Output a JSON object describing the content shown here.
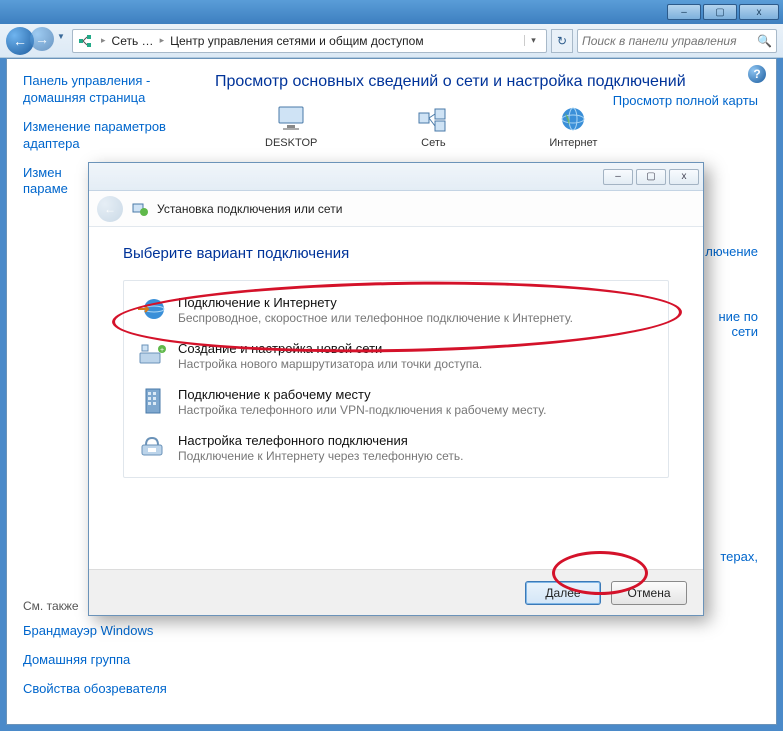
{
  "outer_window": {
    "minimize": "–",
    "maximize": "▢",
    "close": "x"
  },
  "nav": {
    "back_glyph": "←",
    "fwd_glyph": "→",
    "drop_glyph": "▼"
  },
  "address": {
    "crumb1": "Сеть …",
    "crumb2": "Центр управления сетями и общим доступом",
    "sep": "▸",
    "drop": "▾",
    "refresh": "↻"
  },
  "search": {
    "placeholder": "Поиск в панели управления",
    "icon": "🔍"
  },
  "sidebar": {
    "link1": "Панель управления - домашняя страница",
    "link2": "Изменение параметров адаптера",
    "link3": "Измен",
    "link3b": "параме",
    "see_also": "См. также",
    "link4": "Брандмауэр Windows",
    "link5": "Домашняя группа",
    "link6": "Свойства обозревателя"
  },
  "main": {
    "heading": "Просмотр основных сведений о сети и настройка подключений",
    "map_link": "Просмотр полной карты",
    "node1": "DESKTOP",
    "node2": "Сеть",
    "node3": "Интернет",
    "rlink_suffix": "лючение",
    "rlink2a": "ние по",
    "rlink2b": "сети",
    "rlink3": "терах,"
  },
  "wizard": {
    "titlebar": {
      "min": "–",
      "max": "▢",
      "close": "x"
    },
    "back_glyph": "←",
    "title": "Установка подключения или сети",
    "heading": "Выберите вариант подключения",
    "options": [
      {
        "title": "Подключение к Интернету",
        "desc": "Беспроводное, скоростное или телефонное подключение к Интернету."
      },
      {
        "title": "Создание и настройка новой сети",
        "desc": "Настройка нового маршрутизатора или точки доступа."
      },
      {
        "title": "Подключение к рабочему месту",
        "desc": "Настройка телефонного или VPN-подключения к рабочему месту."
      },
      {
        "title": "Настройка телефонного подключения",
        "desc": "Подключение к Интернету через телефонную сеть."
      }
    ],
    "next_btn": "Далее",
    "cancel_btn": "Отмена"
  }
}
